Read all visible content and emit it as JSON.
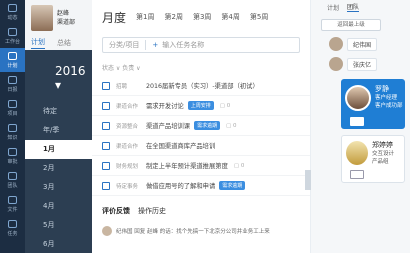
{
  "rail": [
    "动态",
    "工作台",
    "计划",
    "日报",
    "项目",
    "知识",
    "审批",
    "团队",
    "文件",
    "任务"
  ],
  "user": {
    "name": "赵峰",
    "dept": "渠道部"
  },
  "plan_tabs": [
    "计划",
    "总结"
  ],
  "year": "2016",
  "months": [
    "待定",
    "年/季",
    "1月",
    "2月",
    "3月",
    "4月",
    "5月",
    "6月"
  ],
  "selected_month": "1月",
  "main": {
    "title": "月度",
    "weeks": [
      "第1周",
      "第2周",
      "第3周",
      "第4周",
      "第5周"
    ],
    "toolbar": {
      "category": "分类/项目",
      "placeholder": "输入任务名称"
    },
    "filter": "状态 ∨  负责 ∨",
    "tasks": [
      {
        "sub": "招聘",
        "text": "2016届新专员（实习）-渠道部（初试）",
        "tag": "",
        "cmt": ""
      },
      {
        "sub": "渠道合作",
        "text": "需求开发讨论",
        "tag": "上周安排",
        "cmt": "0"
      },
      {
        "sub": "资源整合",
        "text": "渠道产品培训课",
        "tag": "需求逾期",
        "cmt": "0"
      },
      {
        "sub": "渠道合作",
        "text": "在全国渠道商库产品培训",
        "tag": "",
        "cmt": ""
      },
      {
        "sub": "财务规划",
        "text": "制定上半年预计渠道推展第度",
        "tag": "",
        "cmt": "0"
      },
      {
        "sub": "待定事务",
        "text": "做借应用号的了解和申请",
        "tag": "需求逾期",
        "cmt": ""
      }
    ],
    "feedback_tabs": [
      "评价反馈",
      "操作历史"
    ],
    "feedback_line": "纪伟国  回复  赵峰  的话：找个先搞一下北京分公司并业务工上来"
  },
  "team": {
    "tabs": [
      "计划",
      "团队"
    ],
    "back": "返回最上级",
    "nodes": [
      "纪伟国",
      "张庆亿"
    ],
    "card1": {
      "name": "罗静",
      "role": "客户经理\n客户成功部"
    },
    "card2": {
      "name": "郑婷婷",
      "role": "交互设计\n产品组"
    }
  }
}
